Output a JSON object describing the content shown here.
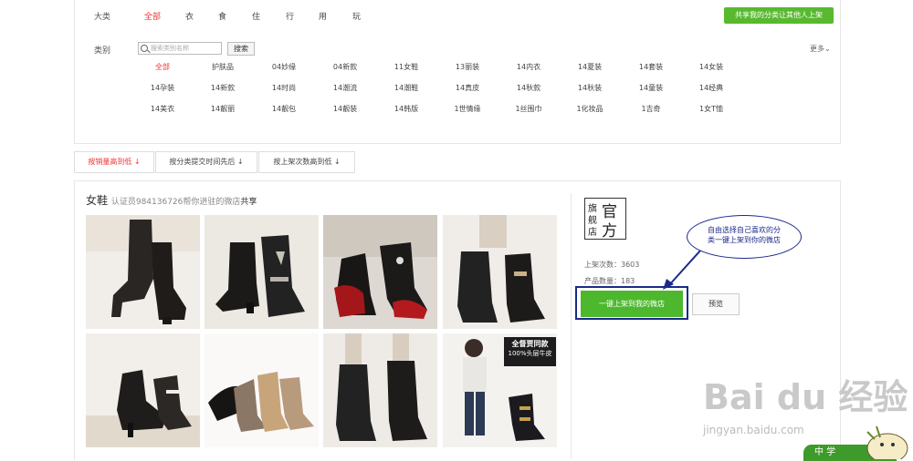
{
  "filters": {
    "main_label": "大类",
    "main_categories": [
      "全部",
      "衣",
      "食",
      "住",
      "行",
      "用",
      "玩"
    ],
    "share_button": "共享我的分类让其他人上架",
    "sub_label": "类别",
    "search_placeholder": "搜索类别名称",
    "search_button": "搜索",
    "more_label": "更多",
    "tags": [
      [
        "全部",
        "护肤品",
        "04妙缘",
        "04新款",
        "11女鞋",
        "13丽装",
        "14内衣",
        "14夏装",
        "14套装",
        "14女装"
      ],
      [
        "14孕装",
        "14新款",
        "14时尚",
        "14潮流",
        "14潮鞋",
        "14真皮",
        "14秋款",
        "14秋装",
        "14童装",
        "14经典"
      ],
      [
        "14美衣",
        "14靓丽",
        "14靓包",
        "14靓装",
        "14韩版",
        "1世情缘",
        "1丝围巾",
        "1化妆品",
        "1吉奇",
        "1女T恤"
      ]
    ]
  },
  "sort_tabs": [
    "按销量高到低",
    "按分类提交时间先后",
    "按上架次数高到低"
  ],
  "shop": {
    "title": "女鞋",
    "subtitle_prefix": "认证员984136726帮你进驻的微店",
    "subtitle_link": "共享",
    "logo_chars": [
      "旗",
      "舰",
      "店",
      "官",
      "方"
    ],
    "list_count": "上架次数：3603",
    "product_count": "产品数量：183",
    "list_button": "一键上架到我的微店",
    "preview_button": "预览",
    "promo_line1": "全督贾同款",
    "promo_line2": "100%头层牛皮"
  },
  "annotation": {
    "line1": "自由选择自己喜欢的分",
    "line2": "类一键上架到你的微店"
  },
  "watermark": {
    "brand": "Bai du 经验",
    "url": "jingyan.baidu.com"
  },
  "footer_tab": "中   学"
}
